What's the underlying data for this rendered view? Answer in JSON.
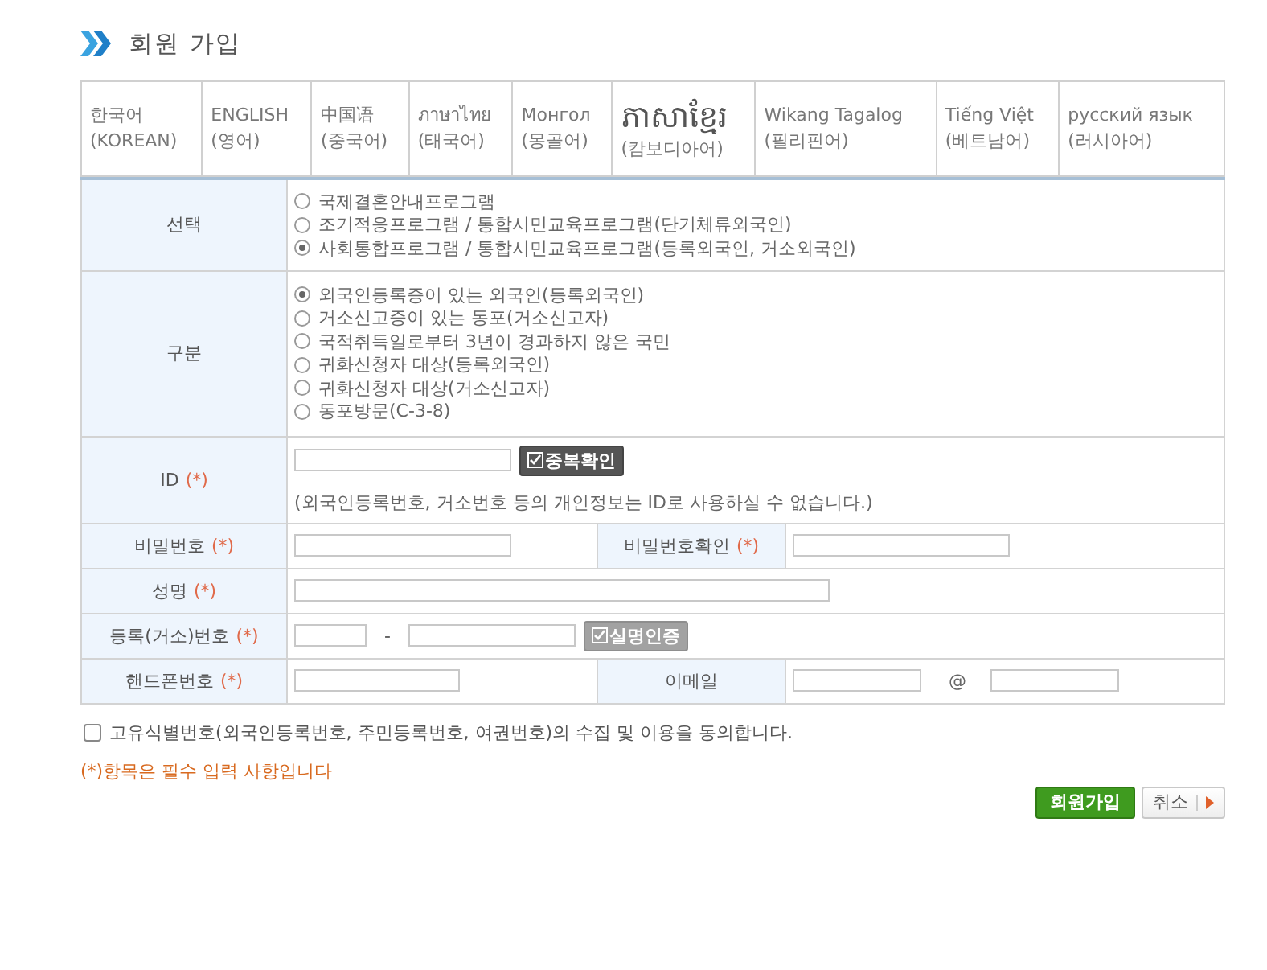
{
  "page_title": "회원 가입",
  "languages": [
    {
      "name": "한국어",
      "subtitle": "(KOREAN)",
      "kind": "text"
    },
    {
      "name": "ENGLISH",
      "subtitle": "(영어)",
      "kind": "text"
    },
    {
      "name": "中国语",
      "subtitle": "(중국어)",
      "kind": "text"
    },
    {
      "name": "ภาษาไทย",
      "subtitle": "(태국어)",
      "kind": "text"
    },
    {
      "name": "Монгол",
      "subtitle": "(몽골어)",
      "kind": "text"
    },
    {
      "name": "ភាសាខ្មែរ",
      "subtitle": "(캄보디아어)",
      "kind": "large"
    },
    {
      "name": "Wikang Tagalog",
      "subtitle": "(필리핀어)",
      "kind": "text"
    },
    {
      "name": "Tiếng Việt",
      "subtitle": "(베트남어)",
      "kind": "text"
    },
    {
      "name": "русский язык",
      "subtitle": "(러시아어)",
      "kind": "text"
    }
  ],
  "form": {
    "program": {
      "label": "선택",
      "options": [
        {
          "label": "국제결혼안내프로그램",
          "selected": false
        },
        {
          "label": "조기적응프로그램 / 통합시민교육프로그램(단기체류외국인)",
          "selected": false
        },
        {
          "label": "사회통합프로그램 / 통합시민교육프로그램(등록외국인, 거소외국인)",
          "selected": true
        }
      ]
    },
    "category": {
      "label": "구분",
      "options": [
        {
          "label": "외국인등록증이 있는 외국인(등록외국인)",
          "selected": true
        },
        {
          "label": "거소신고증이 있는 동포(거소신고자)",
          "selected": false
        },
        {
          "label": "국적취득일로부터 3년이 경과하지 않은 국민",
          "selected": false
        },
        {
          "label": "귀화신청자 대상(등록외국인)",
          "selected": false
        },
        {
          "label": "귀화신청자 대상(거소신고자)",
          "selected": false
        },
        {
          "label": "동포방문(C-3-8)",
          "selected": false
        }
      ]
    },
    "id": {
      "label": "ID",
      "required_mark": "(*)",
      "button": {
        "label": "중복확인",
        "disabled": false
      },
      "note": "(외국인등록번호, 거소번호 등의 개인정보는 ID로 사용하실 수 없습니다.)"
    },
    "password": {
      "label": "비밀번호",
      "required_mark": "(*)"
    },
    "password_confirm": {
      "label": "비밀번호확인",
      "required_mark": "(*)"
    },
    "name": {
      "label": "성명",
      "required_mark": "(*)"
    },
    "registration_number": {
      "label": "등록(거소)번호",
      "required_mark": "(*)",
      "separator": "-",
      "button": {
        "label": "실명인증",
        "disabled": true
      }
    },
    "phone": {
      "label": "핸드폰번호",
      "required_mark": "(*)"
    },
    "email": {
      "label": "이메일",
      "separator": "@"
    }
  },
  "agreement": {
    "label": "고유식별번호(외국인등록번호, 주민등록번호, 여권번호)의 수집 및 이용을 동의합니다.",
    "checked": false
  },
  "required_note": "(*)항목은 필수 입력 사항입니다",
  "buttons": [
    {
      "label": "회원가입",
      "kind": "primary"
    },
    {
      "label": "취소",
      "kind": "cancel"
    }
  ]
}
